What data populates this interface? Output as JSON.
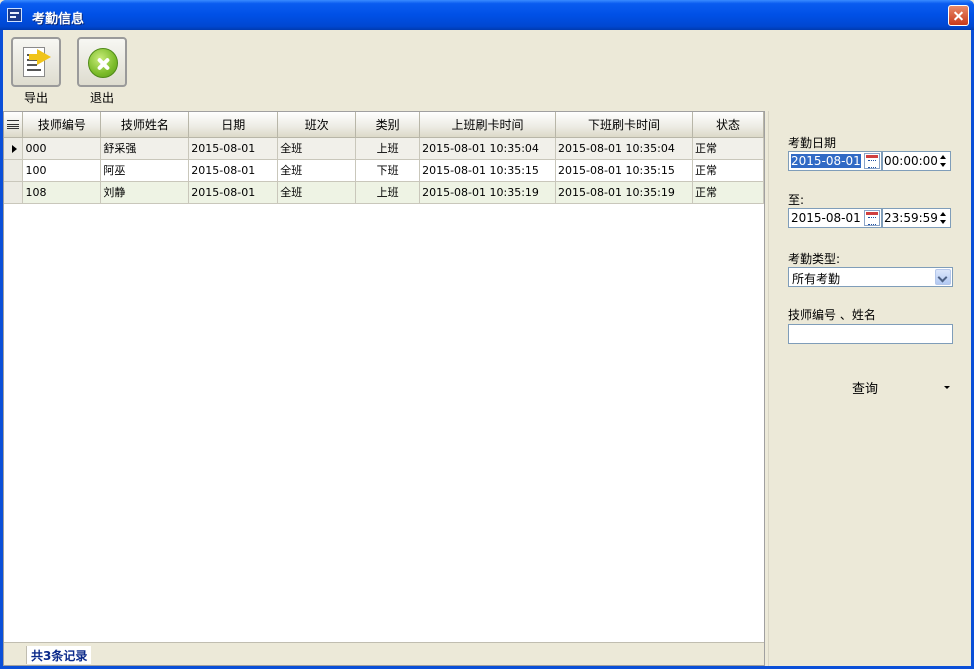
{
  "window": {
    "title": "考勤信息"
  },
  "toolbar": {
    "export_label": "导出",
    "exit_label": "退出"
  },
  "grid": {
    "columns": [
      "技师编号",
      "技师姓名",
      "日期",
      "班次",
      "类别",
      "上班刷卡时间",
      "下班刷卡时间",
      "状态"
    ],
    "rows": [
      {
        "id": "000",
        "name": "舒采强",
        "date": "2015-08-01",
        "shift": "全班",
        "type": "上班",
        "in_time": "2015-08-01  10:35:04",
        "out_time": "2015-08-01  10:35:04",
        "status": "正常"
      },
      {
        "id": "100",
        "name": "阿巫",
        "date": "2015-08-01",
        "shift": "全班",
        "type": "下班",
        "in_time": "2015-08-01  10:35:15",
        "out_time": "2015-08-01  10:35:15",
        "status": "正常"
      },
      {
        "id": "108",
        "name": "刘静",
        "date": "2015-08-01",
        "shift": "全班",
        "type": "上班",
        "in_time": "2015-08-01  10:35:19",
        "out_time": "2015-08-01  10:35:19",
        "status": "正常"
      }
    ]
  },
  "status_bar": {
    "record_count": "共3条记录"
  },
  "filters": {
    "date_label": "考勤日期",
    "start_date": "2015-08-01",
    "start_time": "00:00:00",
    "to_label": "至:",
    "end_date": "2015-08-01",
    "end_time": "23:59:59",
    "type_label": "考勤类型:",
    "type_value": "所有考勤",
    "search_label": "技师编号 、姓名",
    "search_value": "",
    "query_label": "查询"
  }
}
